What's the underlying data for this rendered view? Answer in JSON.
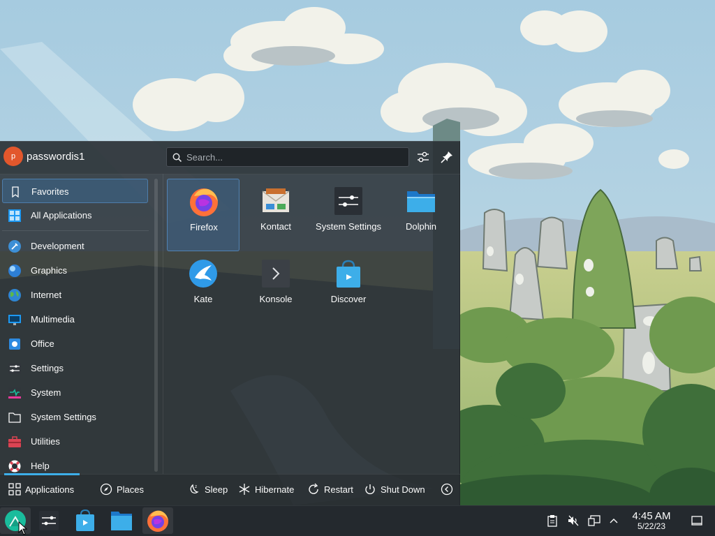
{
  "user": {
    "initial": "p",
    "name": "passwordis1"
  },
  "search": {
    "placeholder": "Search..."
  },
  "sidebar": {
    "items": [
      {
        "label": "Favorites",
        "icon": "bookmark-icon",
        "selected": true
      },
      {
        "label": "All Applications",
        "icon": "all-apps-grid-icon"
      },
      {
        "label": "Development",
        "icon": "development-icon"
      },
      {
        "label": "Graphics",
        "icon": "graphics-icon"
      },
      {
        "label": "Internet",
        "icon": "internet-globe-icon"
      },
      {
        "label": "Multimedia",
        "icon": "multimedia-icon"
      },
      {
        "label": "Office",
        "icon": "office-icon"
      },
      {
        "label": "Settings",
        "icon": "settings-sliders-icon"
      },
      {
        "label": "System",
        "icon": "system-icon"
      },
      {
        "label": "System Settings",
        "icon": "folder-icon"
      },
      {
        "label": "Utilities",
        "icon": "toolbox-icon"
      },
      {
        "label": "Help",
        "icon": "lifebuoy-icon"
      }
    ]
  },
  "favorites": [
    {
      "label": "Firefox",
      "icon": "firefox-icon",
      "selected": true
    },
    {
      "label": "Kontact",
      "icon": "kontact-icon"
    },
    {
      "label": "System Settings",
      "icon": "system-settings-icon"
    },
    {
      "label": "Dolphin",
      "icon": "dolphin-folder-icon"
    },
    {
      "label": "Kate",
      "icon": "kate-icon"
    },
    {
      "label": "Konsole",
      "icon": "konsole-icon"
    },
    {
      "label": "Discover",
      "icon": "discover-icon"
    }
  ],
  "footer": {
    "applications": "Applications",
    "places": "Places",
    "sleep": "Sleep",
    "hibernate": "Hibernate",
    "restart": "Restart",
    "shutdown": "Shut Down"
  },
  "taskbar": {
    "apps": [
      "app-launcher-icon",
      "system-settings-icon",
      "discover-icon",
      "dolphin-folder-icon",
      "firefox-icon"
    ]
  },
  "clock": {
    "time": "4:45 AM",
    "date": "5/22/23"
  },
  "colors": {
    "accent": "#3daee9",
    "panel": "#24292e",
    "avatar": "#e2572c"
  }
}
